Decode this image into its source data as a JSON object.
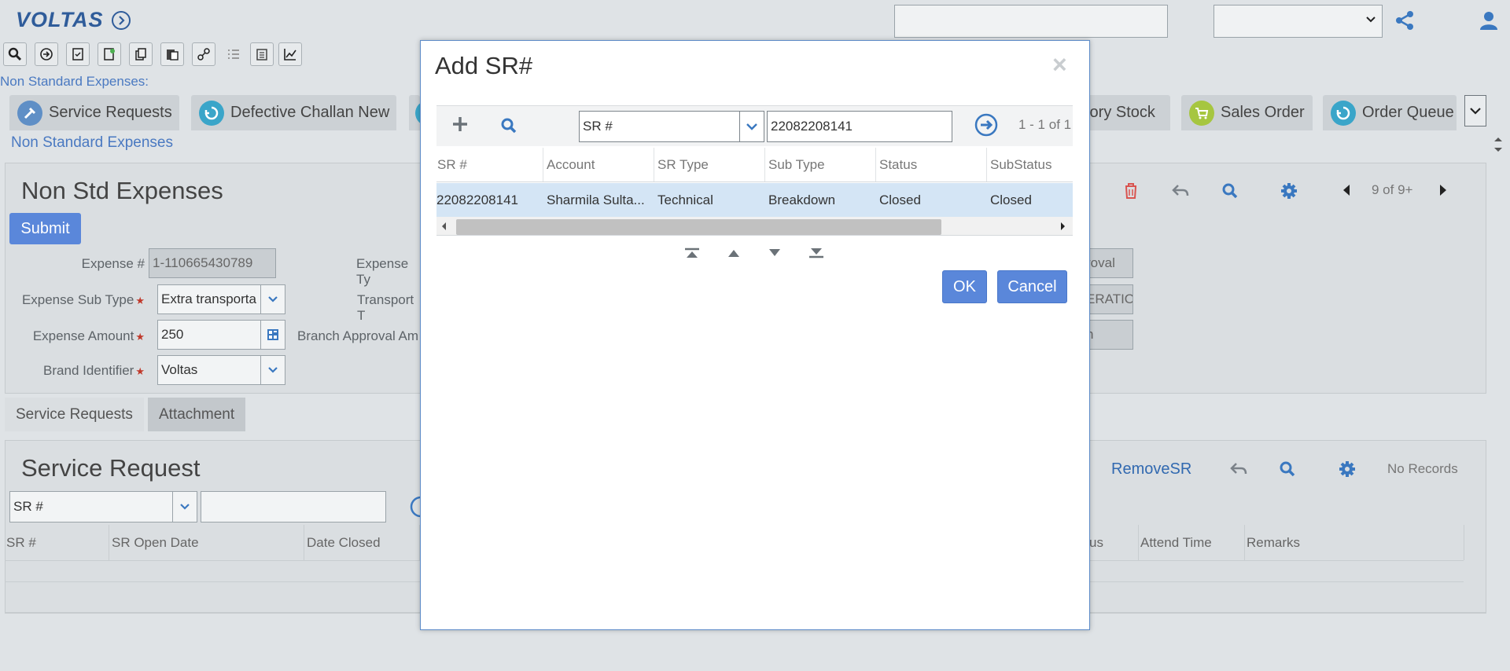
{
  "header": {
    "logo_text": "VOLTAS",
    "search_value": "",
    "select_value": ""
  },
  "breadcrumb": {
    "top": "Non Standard Expenses:",
    "link": "Non Standard Expenses"
  },
  "nav_tabs": [
    {
      "label": "Service Requests",
      "icon": "tools-icon",
      "color": "#5f8fc6"
    },
    {
      "label": "Defective Challan New",
      "icon": "recycle-icon",
      "color": "#3aa5c9"
    },
    {
      "label": "tory Stock",
      "icon": "",
      "color": ""
    },
    {
      "label": "Sales Order",
      "icon": "cart-icon",
      "color": "#a6c640"
    },
    {
      "label": "Order Queue",
      "icon": "recycle-icon",
      "color": "#3aa5c9"
    }
  ],
  "form": {
    "title": "Non Std Expenses",
    "submit_label": "Submit",
    "record_count": "9 of 9+",
    "fields": {
      "expense_no": {
        "label": "Expense #",
        "value": "1-110665430789"
      },
      "expense_sub_type": {
        "label": "Expense Sub Type",
        "value": "Extra transporta"
      },
      "expense_amount": {
        "label": "Expense Amount",
        "value": "250"
      },
      "brand_identifier": {
        "label": "Brand Identifier",
        "value": "Voltas"
      },
      "expense_type": {
        "label": "Expense Ty"
      },
      "transport": {
        "label": "Transport T"
      },
      "branch_approval": {
        "label": "Branch Approval Am"
      }
    },
    "right_fields": [
      "roval",
      "ERATIO",
      "n"
    ]
  },
  "subtabs": [
    "Service Requests",
    "Attachment"
  ],
  "sr_panel": {
    "title": "Service Request",
    "remove_label": "RemoveSR",
    "no_records": "No Records",
    "query_field": "SR #",
    "query_value": "",
    "columns": [
      "SR #",
      "SR Open Date",
      "Date Closed",
      "us",
      "Attend Time",
      "Remarks"
    ]
  },
  "dialog": {
    "title": "Add SR#",
    "close": "×",
    "query_field": "SR #",
    "query_value": "22082208141",
    "count": "1 - 1 of 1",
    "columns": [
      "SR #",
      "Account",
      "SR Type",
      "Sub Type",
      "Status",
      "SubStatus"
    ],
    "rows": [
      [
        "22082208141",
        "Sharmila Sulta...",
        "Technical",
        "Breakdown",
        "Closed",
        "Closed"
      ]
    ],
    "ok_label": "OK",
    "cancel_label": "Cancel"
  },
  "colors": {
    "accent": "#5a87da",
    "link": "#3169b0",
    "selected_row": "#d4e5f5",
    "delete": "#d9534f"
  }
}
